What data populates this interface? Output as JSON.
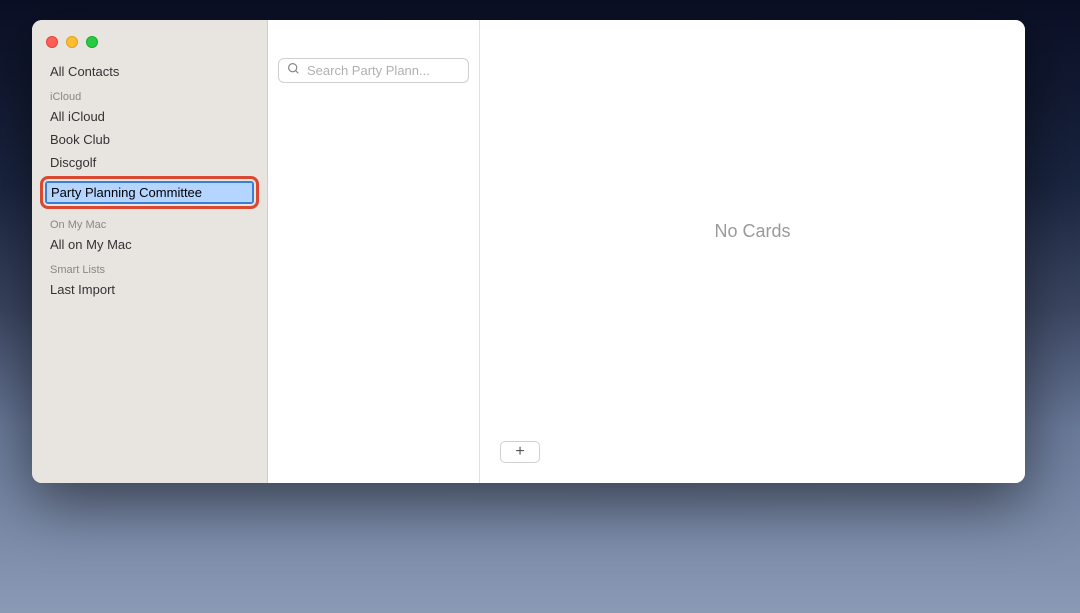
{
  "sidebar": {
    "all_contacts": "All Contacts",
    "sections": {
      "icloud": {
        "header": "iCloud",
        "items": [
          "All iCloud",
          "Book Club",
          "Discgolf"
        ]
      },
      "editing": {
        "value": "Party Planning Committee"
      },
      "on_my_mac": {
        "header": "On My Mac",
        "items": [
          "All on My Mac"
        ]
      },
      "smart_lists": {
        "header": "Smart Lists",
        "items": [
          "Last Import"
        ]
      }
    }
  },
  "search": {
    "placeholder": "Search Party Plann..."
  },
  "detail": {
    "empty_text": "No Cards",
    "add_label": "+"
  }
}
